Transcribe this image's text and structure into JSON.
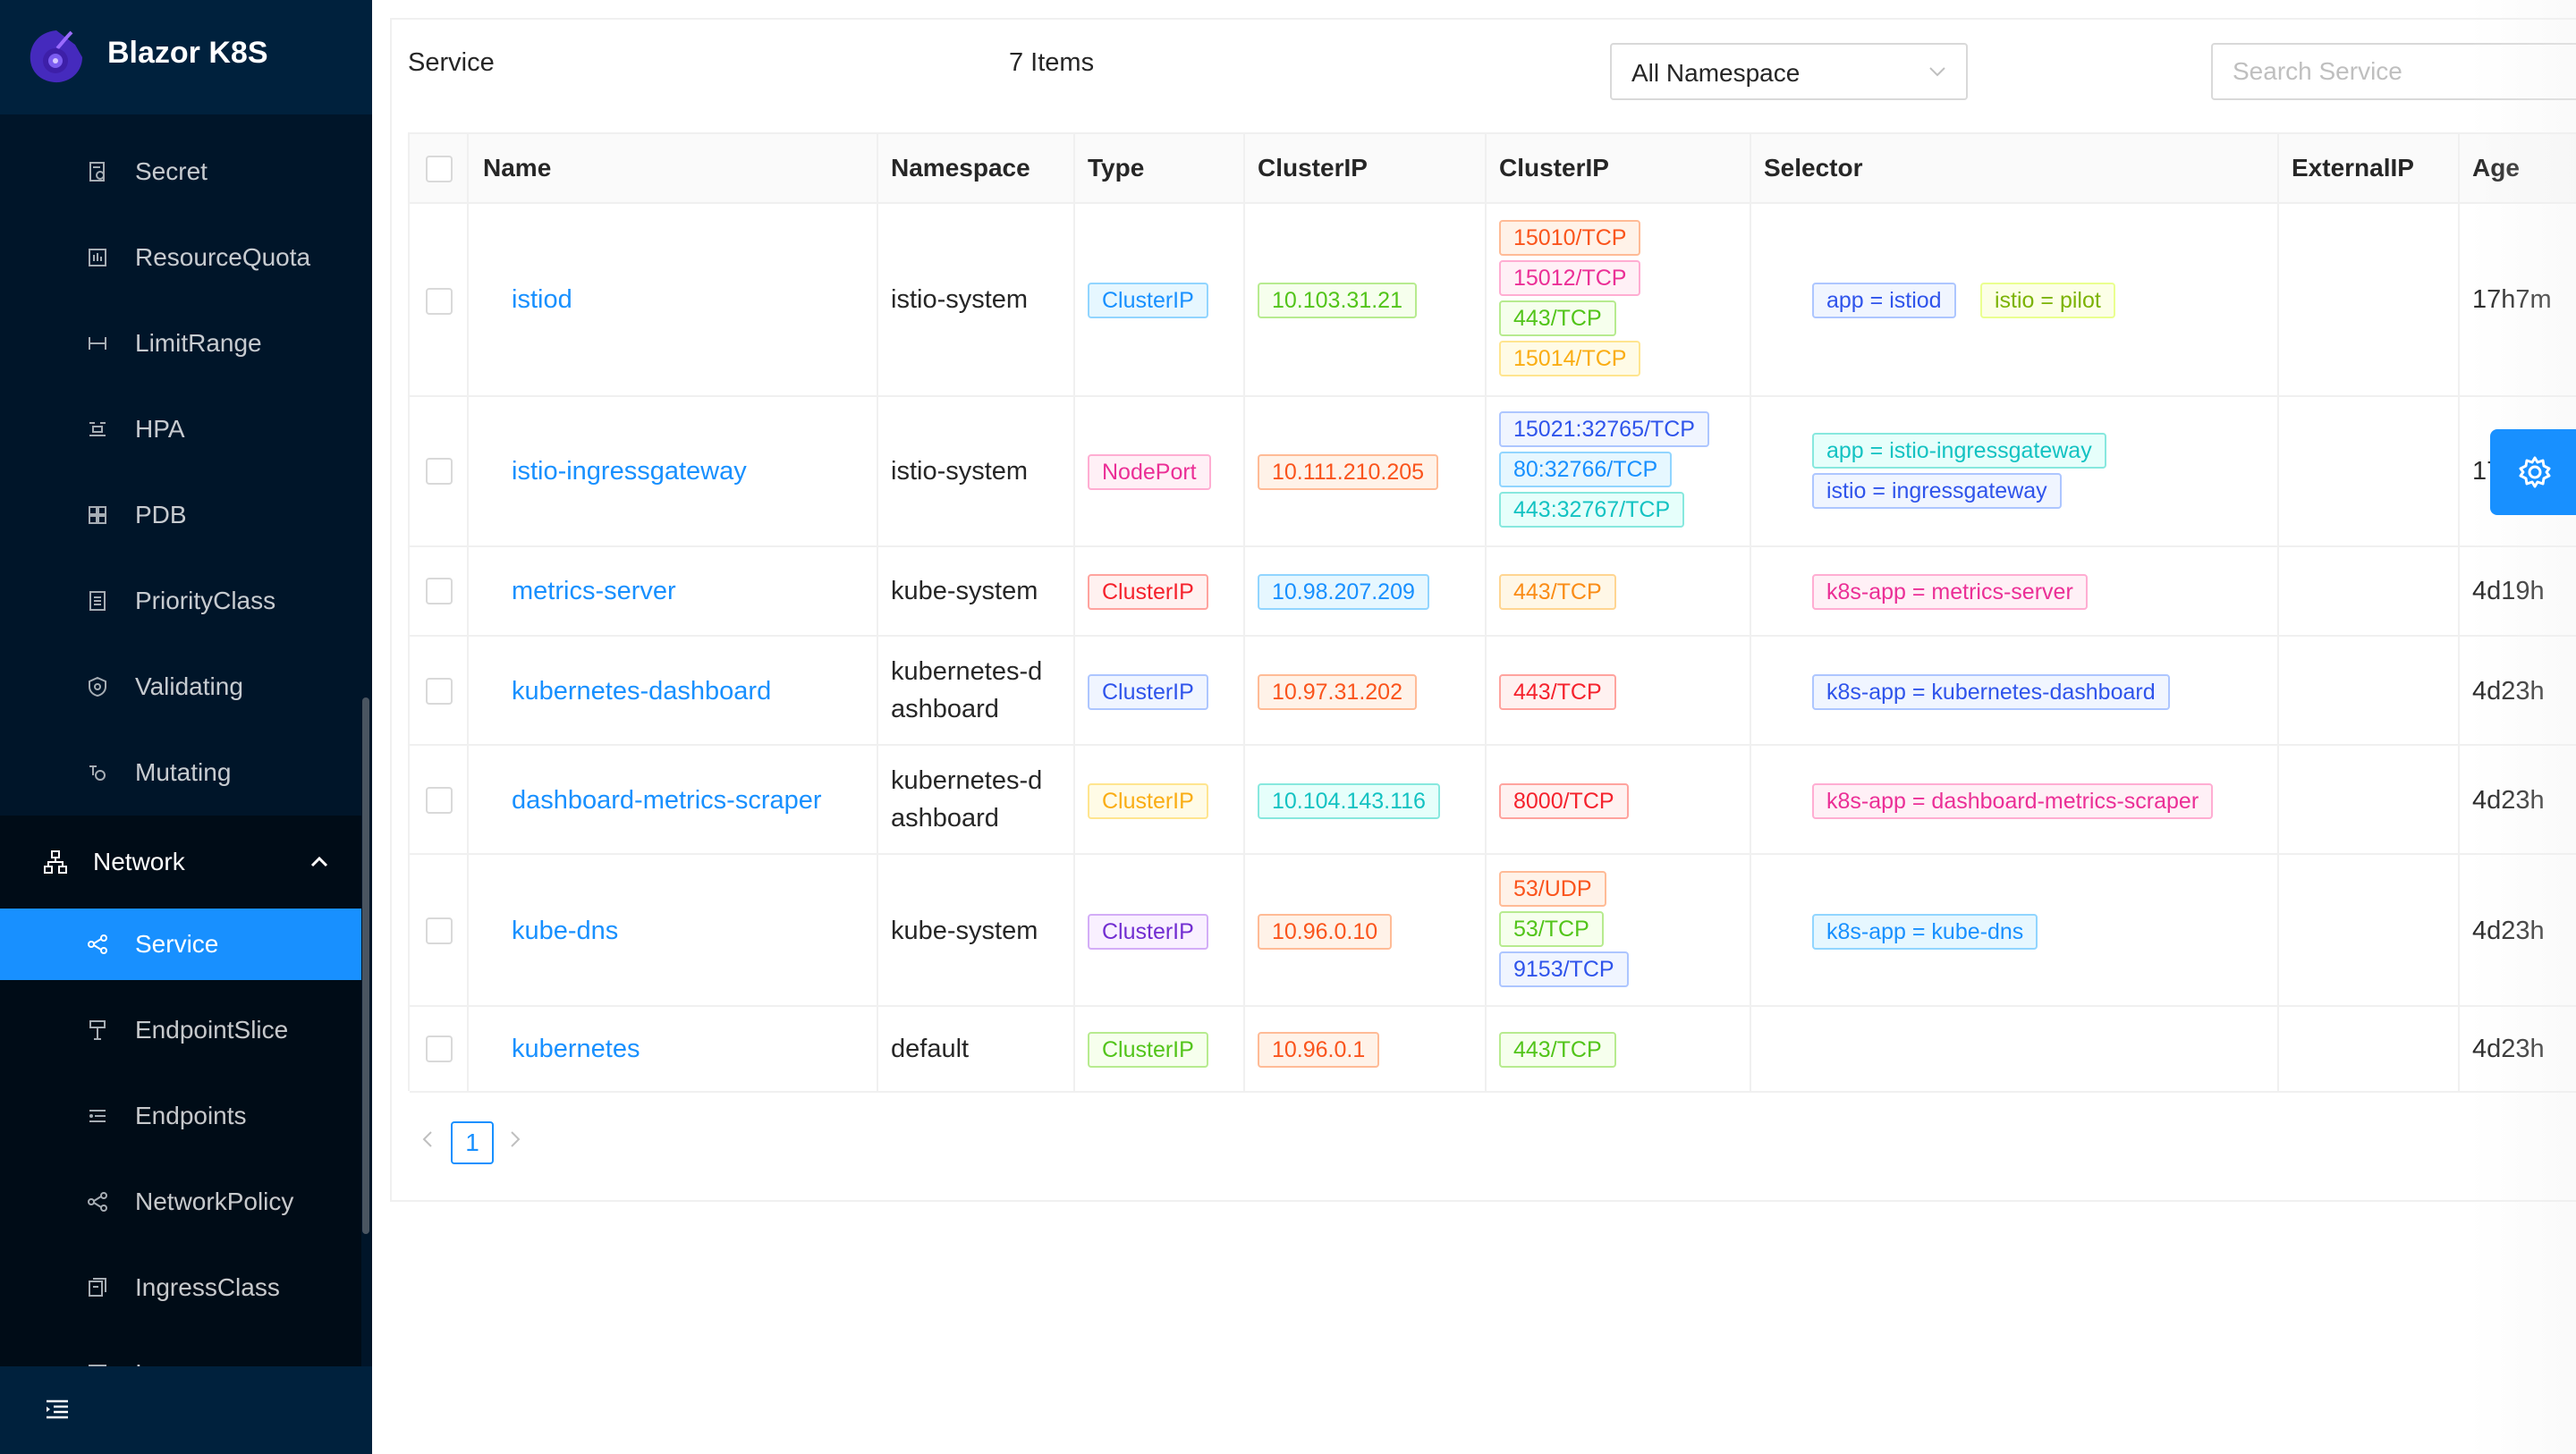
{
  "app": {
    "title": "Blazor K8S"
  },
  "sidebar": {
    "items_top": [
      {
        "label": "Secret",
        "icon": "secret-icon"
      },
      {
        "label": "ResourceQuota",
        "icon": "resource-quota-icon"
      },
      {
        "label": "LimitRange",
        "icon": "limit-range-icon"
      },
      {
        "label": "HPA",
        "icon": "hpa-icon"
      },
      {
        "label": "PDB",
        "icon": "pdb-icon"
      },
      {
        "label": "PriorityClass",
        "icon": "priority-class-icon"
      },
      {
        "label": "Validating",
        "icon": "validating-icon"
      },
      {
        "label": "Mutating",
        "icon": "mutating-icon"
      }
    ],
    "group": {
      "label": "Network",
      "icon": "network-icon"
    },
    "sub_items": [
      {
        "label": "Service",
        "icon": "service-icon",
        "active": true
      },
      {
        "label": "EndpointSlice",
        "icon": "endpointslice-icon"
      },
      {
        "label": "Endpoints",
        "icon": "endpoints-icon"
      },
      {
        "label": "NetworkPolicy",
        "icon": "networkpolicy-icon"
      },
      {
        "label": "IngressClass",
        "icon": "ingressclass-icon"
      },
      {
        "label": "I",
        "icon": "ingress-icon"
      }
    ]
  },
  "toolbar": {
    "title": "Service",
    "count": "7 Items",
    "namespace": "All Namespace",
    "search_placeholder": "Search Service"
  },
  "table": {
    "headers": [
      "Name",
      "Namespace",
      "Type",
      "ClusterIP",
      "ClusterIP",
      "Selector",
      "ExternalIP",
      "Age"
    ],
    "rows": [
      {
        "name": "istiod",
        "namespace": [
          "istio-system"
        ],
        "type": "ClusterIP",
        "clusterip": "10.103.31.21",
        "ports": [
          "15010/TCP",
          "15012/TCP",
          "443/TCP",
          "15014/TCP"
        ],
        "selectors": [
          "app = istiod",
          "istio = pilot"
        ],
        "age": "17h7m"
      },
      {
        "name": "istio-ingressgateway",
        "namespace": [
          "istio-system"
        ],
        "type": "NodePort",
        "clusterip": "10.111.210.205",
        "ports": [
          "15021:32765/TCP",
          "80:32766/TCP",
          "443:32767/TCP"
        ],
        "selectors": [
          "app = istio-ingressgateway",
          "istio = ingressgateway"
        ],
        "age": "17"
      },
      {
        "name": "metrics-server",
        "namespace": [
          "kube-system"
        ],
        "type": "ClusterIP",
        "clusterip": "10.98.207.209",
        "ports": [
          "443/TCP"
        ],
        "selectors": [
          "k8s-app = metrics-server"
        ],
        "age": "4d19h"
      },
      {
        "name": "kubernetes-dashboard",
        "namespace": [
          "kubernetes-d",
          "ashboard"
        ],
        "type": "ClusterIP",
        "clusterip": "10.97.31.202",
        "ports": [
          "443/TCP"
        ],
        "selectors": [
          "k8s-app = kubernetes-dashboard"
        ],
        "age": "4d23h"
      },
      {
        "name": "dashboard-metrics-scraper",
        "namespace": [
          "kubernetes-d",
          "ashboard"
        ],
        "type": "ClusterIP",
        "clusterip": "10.104.143.116",
        "ports": [
          "8000/TCP"
        ],
        "selectors": [
          "k8s-app = dashboard-metrics-scraper"
        ],
        "age": "4d23h"
      },
      {
        "name": "kube-dns",
        "namespace": [
          "kube-system"
        ],
        "type": "ClusterIP",
        "clusterip": "10.96.0.10",
        "ports": [
          "53/UDP",
          "53/TCP",
          "9153/TCP"
        ],
        "selectors": [
          "k8s-app = kube-dns"
        ],
        "age": "4d23h"
      },
      {
        "name": "kubernetes",
        "namespace": [
          "default"
        ],
        "type": "ClusterIP",
        "clusterip": "10.96.0.1",
        "ports": [
          "443/TCP"
        ],
        "selectors": [],
        "age": "4d23h"
      }
    ]
  },
  "pagination": {
    "current": "1"
  },
  "colors": {
    "sidebar": "#001529",
    "primary": "#1890ff"
  }
}
